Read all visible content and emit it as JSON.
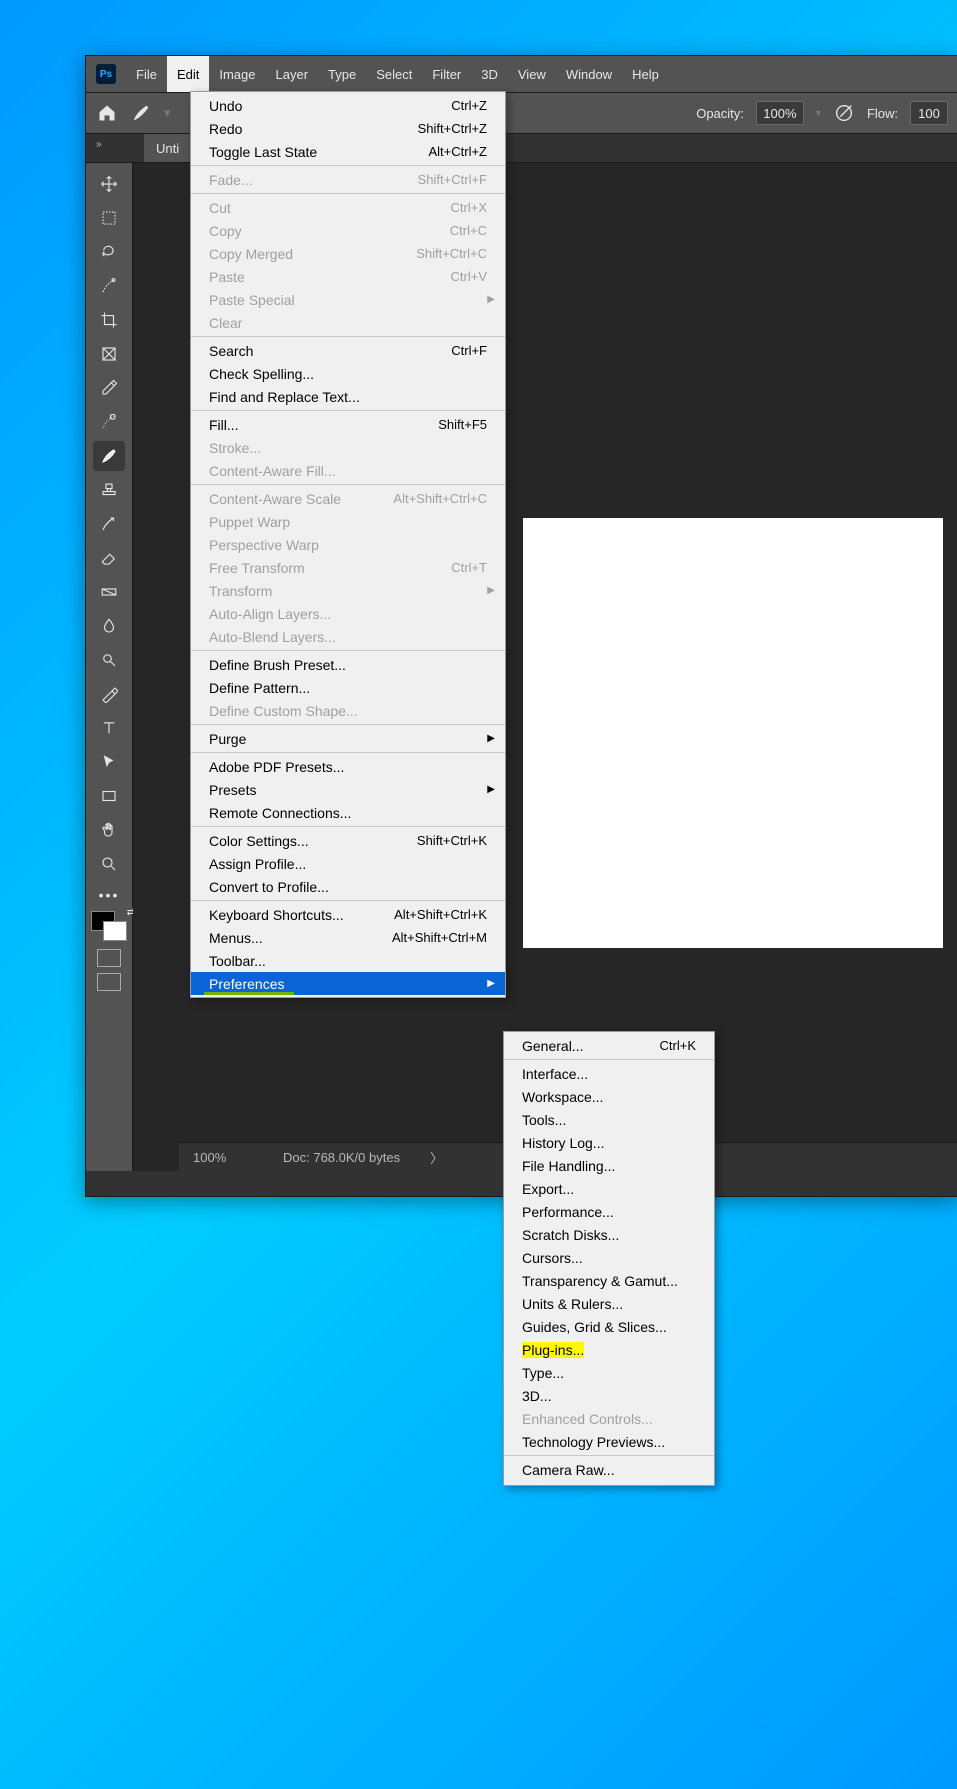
{
  "menubar": [
    "File",
    "Edit",
    "Image",
    "Layer",
    "Type",
    "Select",
    "Filter",
    "3D",
    "View",
    "Window",
    "Help"
  ],
  "active_menu_index": 1,
  "options": {
    "opacity_label": "Opacity:",
    "opacity_value": "100%",
    "flow_label": "Flow:",
    "flow_value": "100"
  },
  "tab_label": "Unti",
  "statusbar": {
    "zoom": "100%",
    "doc": "Doc: 768.0K/0 bytes",
    "arrow": "〉"
  },
  "ps_logo_text": "Ps",
  "edit_menu": [
    {
      "items": [
        {
          "label": "Undo",
          "shortcut": "Ctrl+Z"
        },
        {
          "label": "Redo",
          "shortcut": "Shift+Ctrl+Z"
        },
        {
          "label": "Toggle Last State",
          "shortcut": "Alt+Ctrl+Z"
        }
      ]
    },
    {
      "items": [
        {
          "label": "Fade...",
          "shortcut": "Shift+Ctrl+F",
          "disabled": true
        }
      ]
    },
    {
      "items": [
        {
          "label": "Cut",
          "shortcut": "Ctrl+X",
          "disabled": true
        },
        {
          "label": "Copy",
          "shortcut": "Ctrl+C",
          "disabled": true
        },
        {
          "label": "Copy Merged",
          "shortcut": "Shift+Ctrl+C",
          "disabled": true
        },
        {
          "label": "Paste",
          "shortcut": "Ctrl+V",
          "disabled": true
        },
        {
          "label": "Paste Special",
          "submenu": true,
          "disabled": true
        },
        {
          "label": "Clear",
          "disabled": true
        }
      ]
    },
    {
      "items": [
        {
          "label": "Search",
          "shortcut": "Ctrl+F"
        },
        {
          "label": "Check Spelling..."
        },
        {
          "label": "Find and Replace Text..."
        }
      ]
    },
    {
      "items": [
        {
          "label": "Fill...",
          "shortcut": "Shift+F5"
        },
        {
          "label": "Stroke...",
          "disabled": true
        },
        {
          "label": "Content-Aware Fill...",
          "disabled": true
        }
      ]
    },
    {
      "items": [
        {
          "label": "Content-Aware Scale",
          "shortcut": "Alt+Shift+Ctrl+C",
          "disabled": true
        },
        {
          "label": "Puppet Warp",
          "disabled": true
        },
        {
          "label": "Perspective Warp",
          "disabled": true
        },
        {
          "label": "Free Transform",
          "shortcut": "Ctrl+T",
          "disabled": true
        },
        {
          "label": "Transform",
          "submenu": true,
          "disabled": true
        },
        {
          "label": "Auto-Align Layers...",
          "disabled": true
        },
        {
          "label": "Auto-Blend Layers...",
          "disabled": true
        }
      ]
    },
    {
      "items": [
        {
          "label": "Define Brush Preset..."
        },
        {
          "label": "Define Pattern..."
        },
        {
          "label": "Define Custom Shape...",
          "disabled": true
        }
      ]
    },
    {
      "items": [
        {
          "label": "Purge",
          "submenu": true
        }
      ]
    },
    {
      "items": [
        {
          "label": "Adobe PDF Presets..."
        },
        {
          "label": "Presets",
          "submenu": true
        },
        {
          "label": "Remote Connections..."
        }
      ]
    },
    {
      "items": [
        {
          "label": "Color Settings...",
          "shortcut": "Shift+Ctrl+K"
        },
        {
          "label": "Assign Profile..."
        },
        {
          "label": "Convert to Profile..."
        }
      ]
    },
    {
      "items": [
        {
          "label": "Keyboard Shortcuts...",
          "shortcut": "Alt+Shift+Ctrl+K"
        },
        {
          "label": "Menus...",
          "shortcut": "Alt+Shift+Ctrl+M"
        },
        {
          "label": "Toolbar..."
        },
        {
          "label": "Preferences",
          "submenu": true,
          "highlighted": true,
          "underline": true
        }
      ]
    }
  ],
  "pref_menu": [
    {
      "items": [
        {
          "label": "General...",
          "shortcut": "Ctrl+K"
        }
      ]
    },
    {
      "items": [
        {
          "label": "Interface..."
        },
        {
          "label": "Workspace..."
        },
        {
          "label": "Tools..."
        },
        {
          "label": "History Log..."
        },
        {
          "label": "File Handling..."
        },
        {
          "label": "Export..."
        },
        {
          "label": "Performance..."
        },
        {
          "label": "Scratch Disks..."
        },
        {
          "label": "Cursors..."
        },
        {
          "label": "Transparency & Gamut..."
        },
        {
          "label": "Units & Rulers..."
        },
        {
          "label": "Guides, Grid & Slices..."
        },
        {
          "label": "Plug-ins...",
          "yellow": true
        },
        {
          "label": "Type..."
        },
        {
          "label": "3D..."
        },
        {
          "label": "Enhanced Controls...",
          "disabled": true
        },
        {
          "label": "Technology Previews..."
        }
      ]
    },
    {
      "items": [
        {
          "label": "Camera Raw..."
        }
      ]
    }
  ],
  "tools": [
    {
      "name": "move-tool"
    },
    {
      "name": "marquee-tool"
    },
    {
      "name": "lasso-tool"
    },
    {
      "name": "selection-brush-tool"
    },
    {
      "name": "crop-tool"
    },
    {
      "name": "frame-tool"
    },
    {
      "name": "eyedropper-tool"
    },
    {
      "name": "healing-brush-tool"
    },
    {
      "name": "brush-tool",
      "selected": true
    },
    {
      "name": "stamp-tool"
    },
    {
      "name": "history-brush-tool"
    },
    {
      "name": "eraser-tool"
    },
    {
      "name": "gradient-tool"
    },
    {
      "name": "blur-tool"
    },
    {
      "name": "dodge-tool"
    },
    {
      "name": "pen-tool"
    },
    {
      "name": "type-tool"
    },
    {
      "name": "path-selection-tool"
    },
    {
      "name": "rectangle-tool"
    },
    {
      "name": "hand-tool"
    },
    {
      "name": "zoom-tool"
    }
  ]
}
